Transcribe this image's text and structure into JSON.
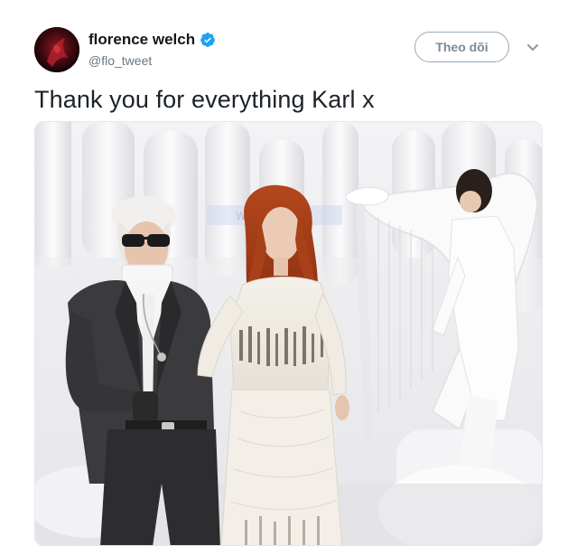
{
  "tweet": {
    "display_name": "florence welch",
    "handle": "@flo_tweet",
    "verified": true,
    "follow_label": "Theo dõi",
    "text": "Thank you for everything Karl x",
    "media_watermark": "Webdayen"
  },
  "icons": {
    "verified": "verified-badge-icon",
    "caret": "chevron-down-icon"
  },
  "colors": {
    "name": "#14171a",
    "secondary": "#657786",
    "verified_blue": "#1da1f2",
    "follow_border": "#9aa9b5"
  }
}
